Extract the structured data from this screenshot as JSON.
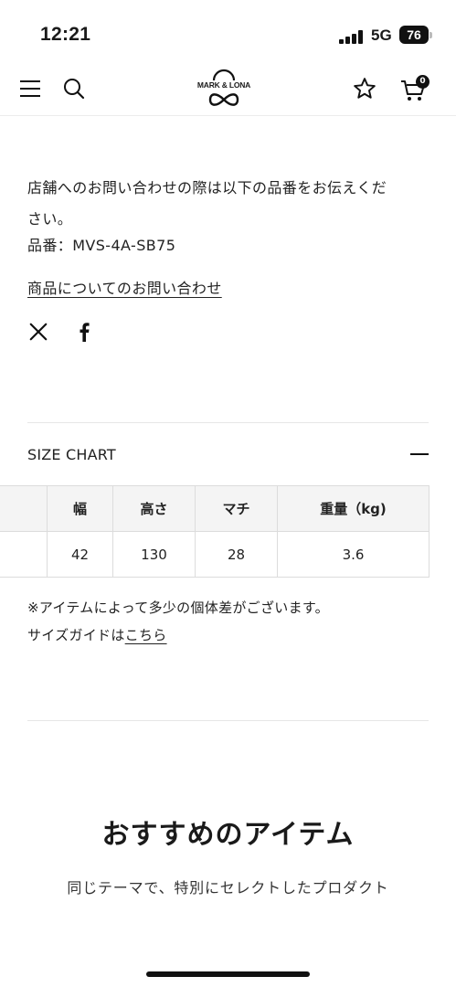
{
  "status_bar": {
    "time": "12:21",
    "network": "5G",
    "battery": "76"
  },
  "header": {
    "logo_text": "MARK & LONA",
    "cart_count": "0"
  },
  "product_info": {
    "inquiry_text_line1": "店舗へのお問い合わせの際は以下の品番をお伝えくだ",
    "inquiry_text_line2": "さい。",
    "product_code": "品番：MVS-4A-SB75",
    "inquiry_link": "商品についてのお問い合わせ"
  },
  "size_chart": {
    "title": "SIZE CHART",
    "columns": [
      "",
      "幅",
      "高さ",
      "マチ",
      "重量（kg)"
    ],
    "rows": [
      [
        "",
        "42",
        "130",
        "28",
        "3.6"
      ]
    ],
    "note": "※アイテムによって多少の個体差がございます。",
    "guide_prefix": "サイズガイドは",
    "guide_link": "こちら"
  },
  "recommend": {
    "title": "おすすめのアイテム",
    "subtitle": "同じテーマで、特別にセレクトしたプロダクト"
  }
}
